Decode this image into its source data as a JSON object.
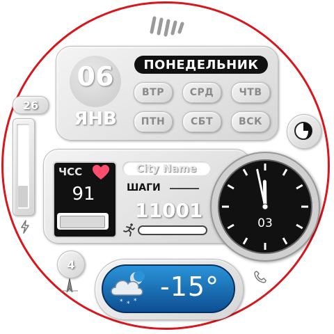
{
  "date": {
    "day_number": "06",
    "month": "ЯНВ",
    "weekday": "ПОНЕДЕЛЬНИК",
    "day_chips": [
      "ВТР",
      "СРД",
      "ЧТВ",
      "ПТН",
      "СБТ",
      "ВСК"
    ]
  },
  "battery": {
    "percent_label": "26",
    "level_fraction": 0.26
  },
  "heart_rate": {
    "label": "ЧСС",
    "value": "91",
    "bar_fraction": 0.95
  },
  "city": {
    "name": "City Name"
  },
  "steps": {
    "label": "ШАГИ",
    "value": "11001",
    "bar_fraction": 0.0
  },
  "analog_clock": {
    "hours": 11,
    "minutes": 58,
    "date_label": "03"
  },
  "notifications": {
    "count": "4"
  },
  "weather": {
    "temperature": "-15°",
    "icon": "cloud-snow-night-icon"
  },
  "icons": {
    "top": "brand-logo-icon",
    "charge": "lightning-icon",
    "moon": "moon-phase-icon",
    "run": "running-person-icon",
    "navigation": "location-arrow-icon",
    "phone": "phone-icon",
    "heart": "heart-icon"
  },
  "colors": {
    "bezel": "#d9161c",
    "heart": "#ff4d6d",
    "weather_bg_top": "#2a93d8",
    "weather_bg_bottom": "#0d4f92"
  }
}
